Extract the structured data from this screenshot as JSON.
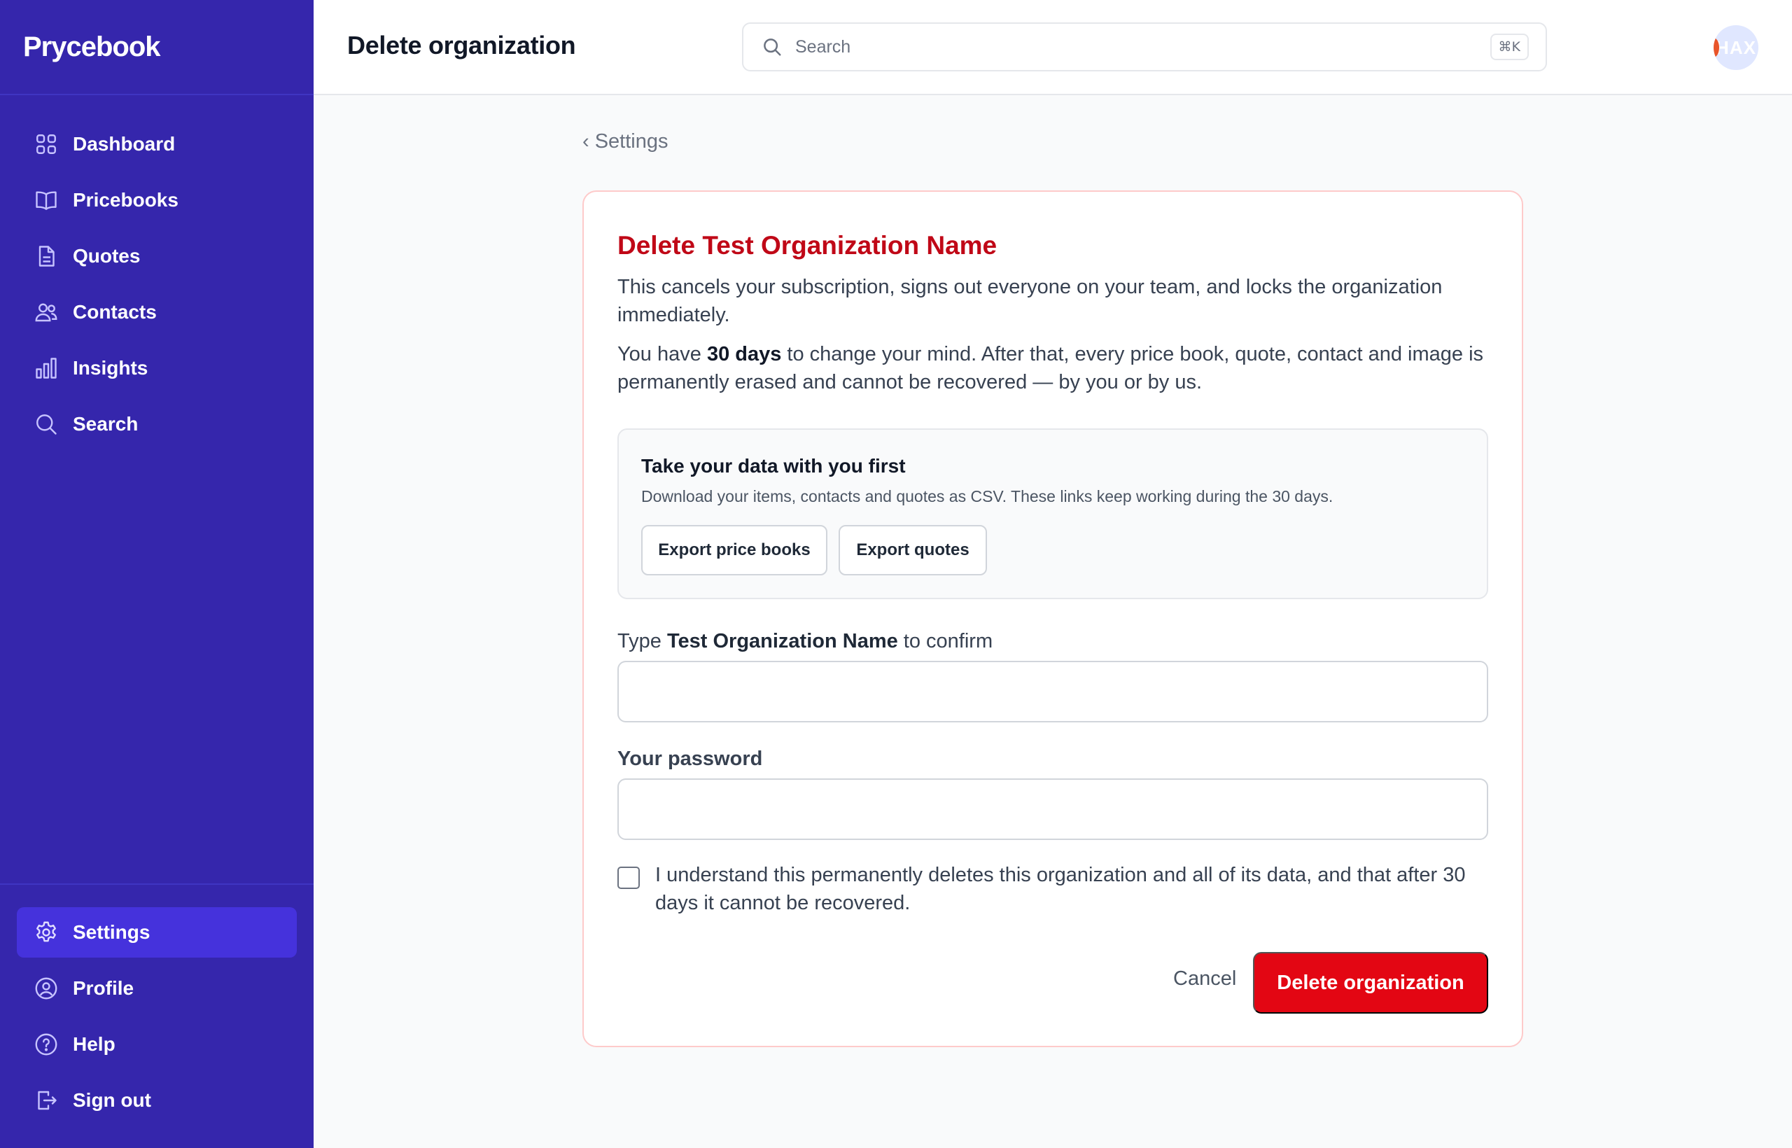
{
  "app": {
    "name": "Prycebook"
  },
  "sidebar": {
    "items": [
      {
        "label": "Dashboard",
        "icon": "dashboard-icon"
      },
      {
        "label": "Pricebooks",
        "icon": "book-icon"
      },
      {
        "label": "Quotes",
        "icon": "document-icon"
      },
      {
        "label": "Contacts",
        "icon": "users-icon"
      },
      {
        "label": "Insights",
        "icon": "bar-chart-icon"
      },
      {
        "label": "Search",
        "icon": "search-icon"
      }
    ],
    "bottom_items": [
      {
        "label": "Settings",
        "icon": "gear-icon",
        "active": true
      },
      {
        "label": "Profile",
        "icon": "user-circle-icon"
      },
      {
        "label": "Help",
        "icon": "help-icon"
      },
      {
        "label": "Sign out",
        "icon": "sign-out-icon"
      }
    ]
  },
  "header": {
    "title": "Delete organization",
    "search_placeholder": "Search",
    "search_shortcut": "⌘K",
    "avatar_initials": "HAX"
  },
  "breadcrumb": {
    "back_label": "‹ Settings"
  },
  "card": {
    "title": "Delete Test Organization Name",
    "paragraph1": "This cancels your subscription, signs out everyone on your team, and locks the organization immediately.",
    "paragraph2_pre": "You have ",
    "paragraph2_bold": "30 days",
    "paragraph2_post": " to change your mind. After that, every price book, quote, contact and image is permanently erased and cannot be recovered — by you or by us.",
    "export": {
      "title": "Take your data with you first",
      "description": "Download your items, contacts and quotes as CSV. These links keep working during the 30 days.",
      "btn_price_books": "Export price books",
      "btn_quotes": "Export quotes"
    },
    "confirm_label_pre": "Type ",
    "confirm_label_bold": "Test Organization Name",
    "confirm_label_post": " to confirm",
    "confirm_value": "",
    "password_label": "Your password",
    "password_value": "",
    "checkbox_text": "I understand this permanently deletes this organization and all of its data, and that after 30 days it cannot be recovered.",
    "checkbox_checked": false,
    "cancel_label": "Cancel",
    "delete_label": "Delete organization"
  },
  "colors": {
    "sidebar_bg": "#3526ac",
    "sidebar_active": "#4532dc",
    "danger": "#e30613",
    "danger_text": "#c00817",
    "card_border": "#fecaca"
  }
}
